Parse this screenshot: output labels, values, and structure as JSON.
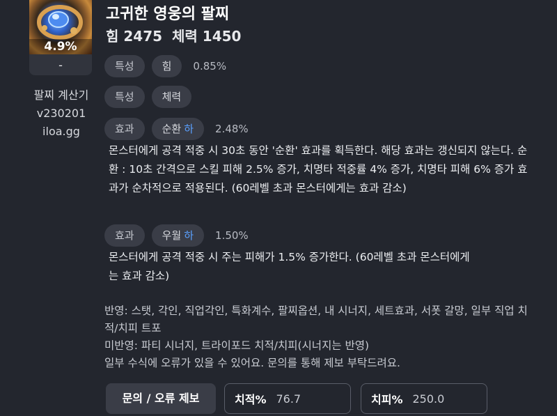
{
  "item": {
    "percent": "4.9%",
    "dash": "-"
  },
  "calculator": {
    "line1": "팔찌 계산기",
    "line2": "v230201",
    "line3": "iloa.gg"
  },
  "title": "고귀한 영웅의 팔찌",
  "stats": {
    "str": "힘 2475",
    "hp": "체력 1450"
  },
  "effects": [
    {
      "type": "특성",
      "name": "힘",
      "grade": "",
      "value": "0.85%"
    },
    {
      "type": "특성",
      "name": "체력",
      "grade": "",
      "value": ""
    },
    {
      "type": "효과",
      "name": "순환",
      "grade": "하",
      "value": "2.48%",
      "desc": "몬스터에게 공격 적중 시 30초 동안 '순환' 효과를 획득한다. 해당 효과는 갱신되지 않는다. 순환 : 10초 간격으로 스킬 피해 2.5% 증가, 치명타 적중률 4% 증가, 치명타 피해 6% 증가 효과가 순차적으로 적용된다. (60레벨 초과 몬스터에게는 효과 감소)"
    },
    {
      "type": "효과",
      "name": "우월",
      "grade": "하",
      "value": "1.50%",
      "desc": "몬스터에게 공격 적중 시 주는 피해가 1.5% 증가한다. (60레벨 초과 몬스터에게는 효과 감소)"
    }
  ],
  "notes": {
    "reflected": "반영: 스탯, 각인, 직업각인, 특화계수, 팔찌옵션, 내 시너지, 세트효과, 서폿 갈망, 일부 직업 치적/치피 트포",
    "not_reflected": "미반영: 파티 시너지, 트라이포드 치적/치피(시너지는 반영)",
    "error_notice": "일부 수식에 오류가 있을 수 있어요. 문의를 통해 제보 부탁드려요."
  },
  "footer": {
    "report_label": "문의 / 오류 제보",
    "crit_rate_label": "치적%",
    "crit_rate_value": "76.7",
    "crit_dmg_label": "치피%",
    "crit_dmg_value": "250.0"
  },
  "icons": {
    "item": "bracelet-icon"
  },
  "colors": {
    "background": "#23262e",
    "pill": "#3a3d47",
    "grade_accent": "#5aa0ff"
  }
}
